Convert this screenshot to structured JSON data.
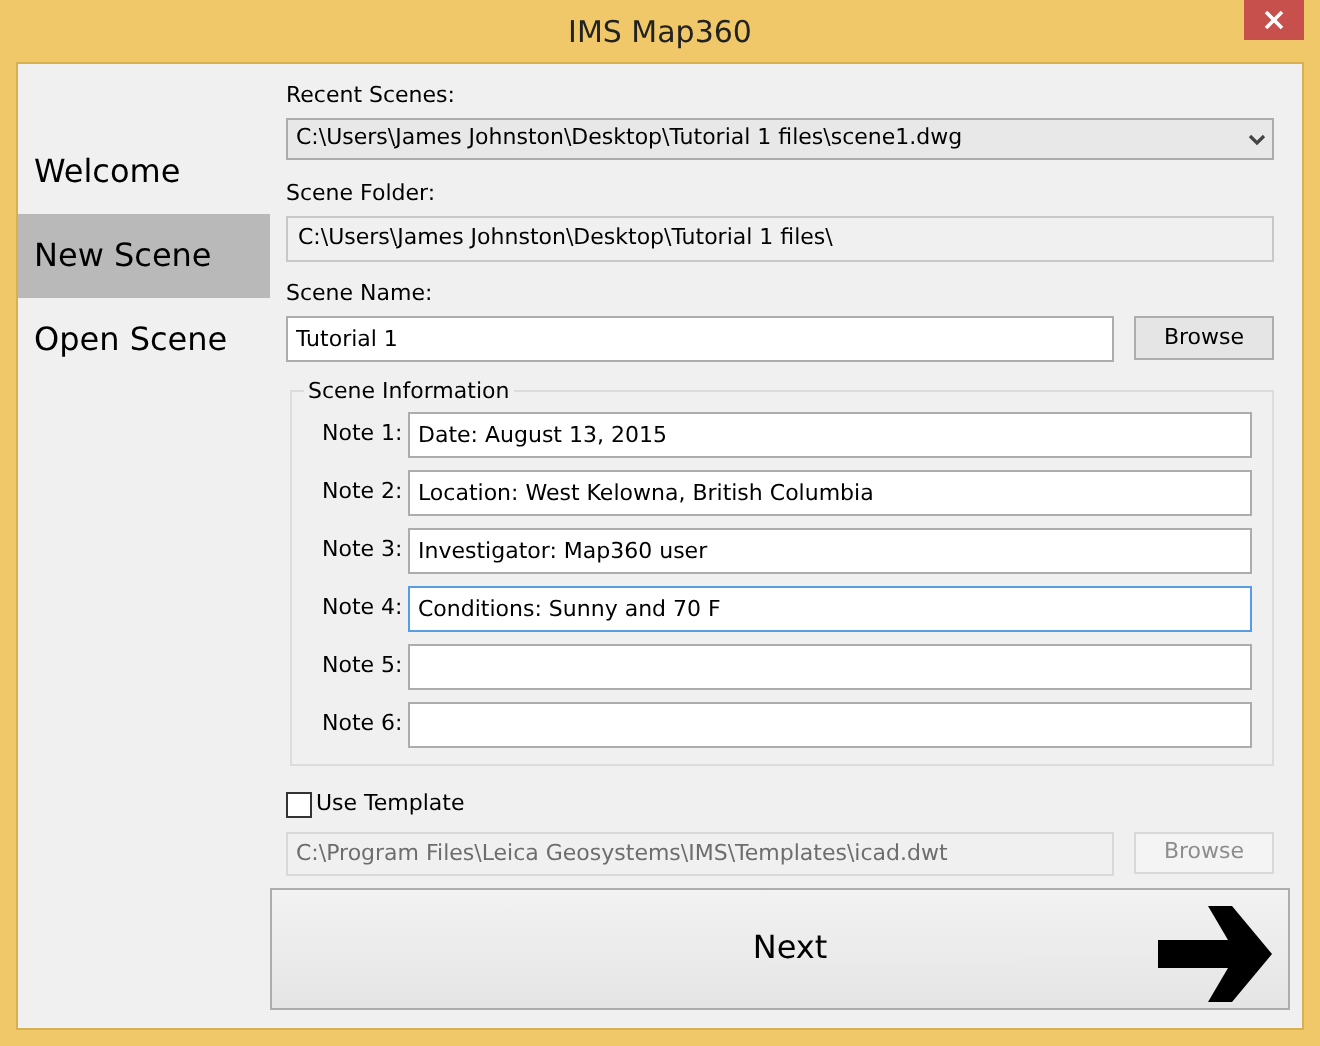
{
  "window": {
    "title": "IMS Map360"
  },
  "sidebar": {
    "items": [
      {
        "label": "Welcome",
        "selected": false
      },
      {
        "label": "New Scene",
        "selected": true
      },
      {
        "label": "Open Scene",
        "selected": false
      }
    ]
  },
  "recent_scenes": {
    "label": "Recent Scenes:",
    "value": "C:\\Users\\James Johnston\\Desktop\\Tutorial 1 files\\scene1.dwg"
  },
  "scene_folder": {
    "label": "Scene Folder:",
    "value": "C:\\Users\\James Johnston\\Desktop\\Tutorial 1 files\\"
  },
  "scene_name": {
    "label": "Scene Name:",
    "value": "Tutorial 1",
    "button": "Browse"
  },
  "scene_information": {
    "title": "Scene Information",
    "notes": [
      {
        "label": "Note 1:",
        "value": "Date: August 13, 2015",
        "focused": false
      },
      {
        "label": "Note 2:",
        "value": "Location: West Kelowna, British Columbia",
        "focused": false
      },
      {
        "label": "Note 3:",
        "value": "Investigator: Map360 user",
        "focused": false
      },
      {
        "label": "Note 4:",
        "value": "Conditions: Sunny and 70 F",
        "focused": true
      },
      {
        "label": "Note 5:",
        "focused": false
      },
      {
        "label": "Note 6:",
        "focused": false
      }
    ]
  },
  "template": {
    "label": "Use Template",
    "checked": false,
    "value": "C:\\Program Files\\Leica Geosystems\\IMS\\Templates\\icad.dwt",
    "disabled": true,
    "button": "Browse"
  },
  "next_button": {
    "label": "Next"
  }
}
